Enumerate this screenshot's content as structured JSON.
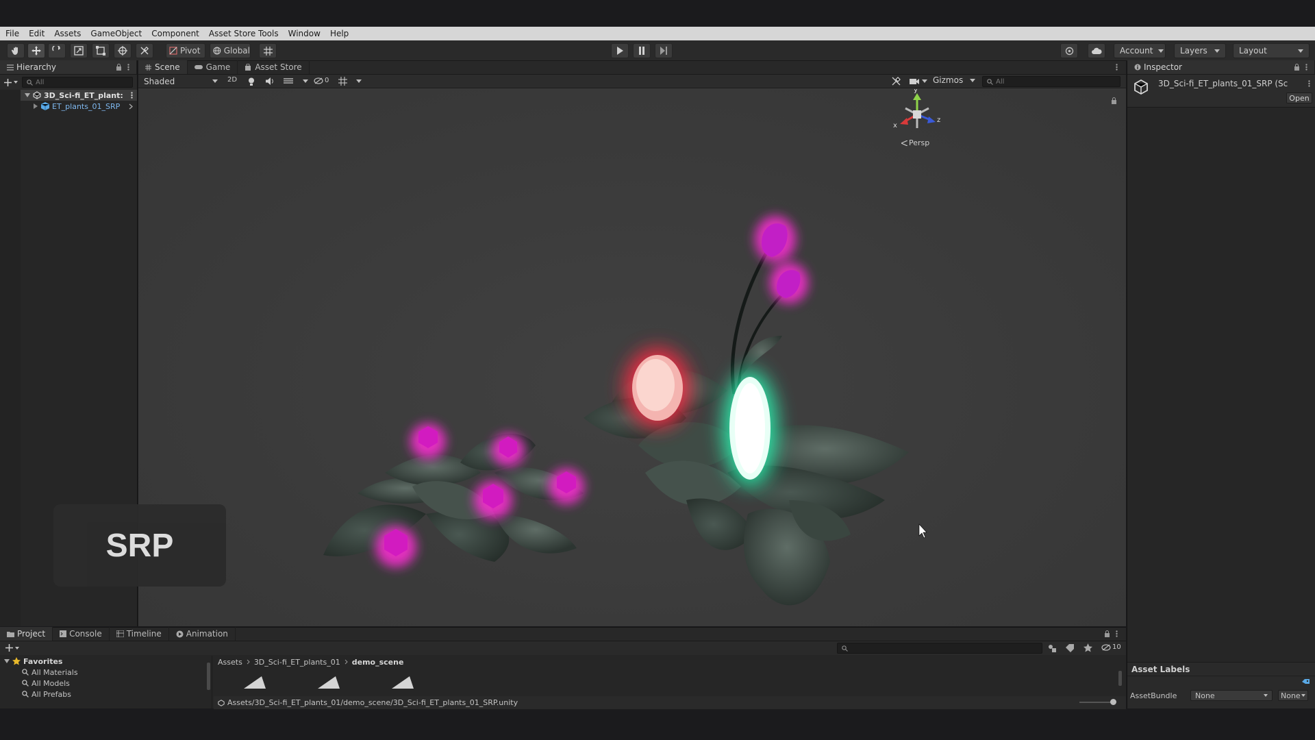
{
  "menu": [
    "File",
    "Edit",
    "Assets",
    "GameObject",
    "Component",
    "Asset Store Tools",
    "Window",
    "Help"
  ],
  "toolbar": {
    "pivot_label": "Pivot",
    "global_label": "Global",
    "account_label": "Account",
    "layers_label": "Layers",
    "layout_label": "Layout"
  },
  "hierarchy": {
    "tab_label": "Hierarchy",
    "search_placeholder": "All",
    "scene_name": "3D_Sci-fi_ET_plant:",
    "child_name": "ET_plants_01_SRP"
  },
  "scene_view": {
    "tabs": [
      "Scene",
      "Game",
      "Asset Store"
    ],
    "shading_mode": "Shaded",
    "mode_2d": "2D",
    "hidden_count": "0",
    "gizmos_label": "Gizmos",
    "search_placeholder": "All",
    "projection_label": "Persp",
    "axis_x": "x",
    "axis_y": "y",
    "axis_z": "z",
    "overlay_badge": "SRP"
  },
  "inspector": {
    "tab_label": "Inspector",
    "asset_title": "3D_Sci-fi_ET_plants_01_SRP (Sc",
    "open_button": "Open",
    "asset_labels_header": "Asset Labels",
    "assetbundle_label": "AssetBundle",
    "assetbundle_value": "None",
    "assetbundle_variant": "None"
  },
  "project": {
    "tabs": [
      "Project",
      "Console",
      "Timeline",
      "Animation"
    ],
    "favorites_label": "Favorites",
    "favorites": [
      "All Materials",
      "All Models",
      "All Prefabs"
    ],
    "breadcrumb": [
      "Assets",
      "3D_Sci-fi_ET_plants_01",
      "demo_scene"
    ],
    "hidden_count": "10",
    "status_path": "Assets/3D_Sci-fi_ET_plants_01/demo_scene/3D_Sci-fi_ET_plants_01_SRP.unity"
  },
  "colors": {
    "magenta_glow": "#ff2fd6",
    "red_glow": "#ff2a44",
    "cyan_glow": "#2bffb8",
    "leaf": "#4e5b55"
  }
}
